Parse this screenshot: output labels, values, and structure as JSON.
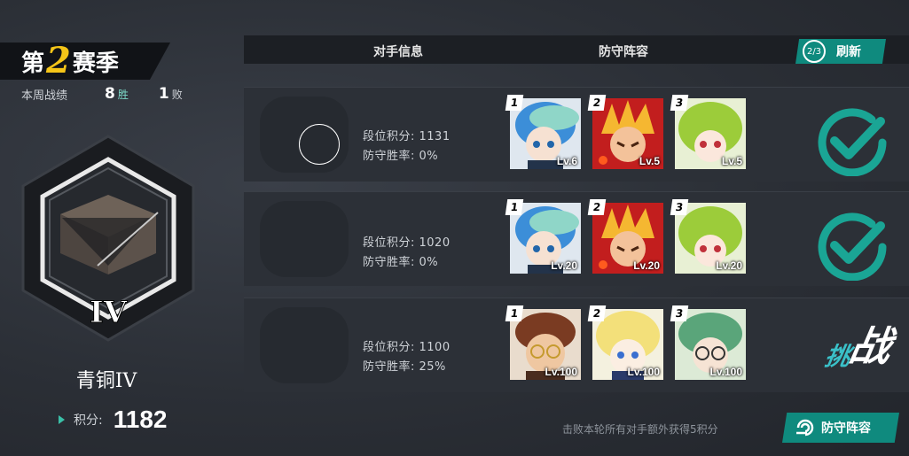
{
  "season": {
    "prefix": "第",
    "number": "2",
    "suffix": "赛季"
  },
  "weekly": {
    "label": "本周战绩",
    "wins": "8",
    "wins_label": "胜",
    "losses": "1",
    "losses_label": "败"
  },
  "rank": {
    "roman": "IV",
    "name": "青铜IV",
    "score_label": "积分:",
    "score": "1182"
  },
  "header": {
    "opponent_info": "对手信息",
    "defense_lineup": "防守阵容",
    "refresh_count": "2/3",
    "refresh_label": "刷新"
  },
  "opponents": [
    {
      "rank_points_label": "段位积分: 1131",
      "win_rate_label": "防守胜率: 0%",
      "status": "defeated",
      "heroes": [
        {
          "slot": "1",
          "level": "Lv.6",
          "icon": "blue-hair-hero-portrait"
        },
        {
          "slot": "2",
          "level": "Lv.5",
          "icon": "fire-hero-portrait"
        },
        {
          "slot": "3",
          "level": "Lv.5",
          "icon": "green-hair-hero-portrait"
        }
      ]
    },
    {
      "rank_points_label": "段位积分: 1020",
      "win_rate_label": "防守胜率: 0%",
      "status": "defeated",
      "heroes": [
        {
          "slot": "1",
          "level": "Lv.20",
          "icon": "blue-hair-hero-portrait"
        },
        {
          "slot": "2",
          "level": "Lv.20",
          "icon": "fire-hero-portrait"
        },
        {
          "slot": "3",
          "level": "Lv.20",
          "icon": "green-hair-hero-portrait"
        }
      ]
    },
    {
      "rank_points_label": "段位积分: 1100",
      "win_rate_label": "防守胜率: 25%",
      "status": "challenge",
      "challenge_a": "挑",
      "challenge_b": "战",
      "heroes": [
        {
          "slot": "1",
          "level": "Lv.100",
          "icon": "glasses-man-hero-portrait"
        },
        {
          "slot": "2",
          "level": "Lv.100",
          "icon": "blonde-hero-portrait"
        },
        {
          "slot": "3",
          "level": "Lv.100",
          "icon": "green-glasses-hero-portrait"
        }
      ]
    }
  ],
  "footer": {
    "note": "击败本轮所有对手额外获得5积分",
    "defense_button": "防守阵容"
  },
  "colors": {
    "accent": "#0f8a7e",
    "check": "#1aa595",
    "gold": "#f5c518"
  }
}
